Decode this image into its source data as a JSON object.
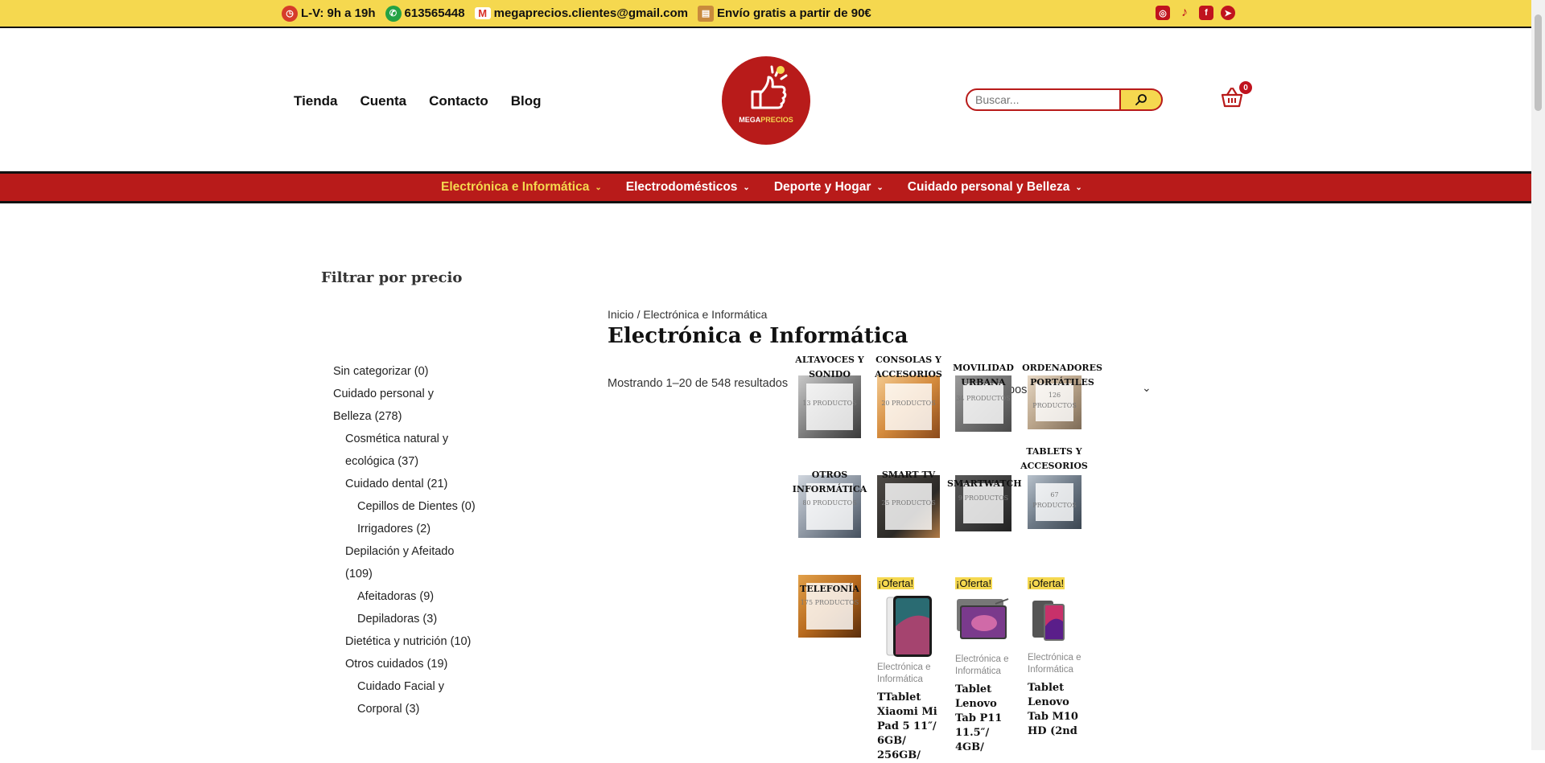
{
  "topbar": {
    "hours": "L-V: 9h a 19h",
    "phone": "613565448",
    "email": "megaprecios.clientes@gmail.com",
    "shipping": "Envío gratis a partir de 90€",
    "social_icons": [
      "instagram-icon",
      "tiktok-icon",
      "facebook-icon",
      "telegram-icon"
    ]
  },
  "nav": [
    "Tienda",
    "Cuenta",
    "Contacto",
    "Blog"
  ],
  "logo": {
    "part1": "MEGA",
    "part2": "PRECIOS"
  },
  "search": {
    "placeholder": "Buscar..."
  },
  "cart": {
    "count": "0"
  },
  "categories_menu": [
    {
      "label": "Electrónica e Informática",
      "active": true
    },
    {
      "label": "Electrodomésticos"
    },
    {
      "label": "Deporte y Hogar"
    },
    {
      "label": "Cuidado personal y Belleza"
    }
  ],
  "sidebar": {
    "filter_title": "Filtrar por precio",
    "categories": [
      {
        "label": "Sin categorizar",
        "count": "(0)"
      },
      {
        "label": "Cuidado personal y Belleza",
        "count": "(278)"
      },
      {
        "label": "Cosmética natural y ecológica",
        "count": "(37)"
      },
      {
        "label": "Cuidado dental",
        "count": "(21)"
      },
      {
        "label": "Cepillos de Dientes",
        "count": "(0)"
      },
      {
        "label": "Irrigadores",
        "count": "(2)"
      },
      {
        "label": "Depilación y Afeitado",
        "count": "(109)"
      },
      {
        "label": "Afeitadoras",
        "count": "(9)"
      },
      {
        "label": "Depiladoras",
        "count": "(3)"
      },
      {
        "label": "Dietética y nutrición",
        "count": "(10)"
      },
      {
        "label": "Otros cuidados",
        "count": "(19)"
      },
      {
        "label": "Cuidado Facial y Corporal",
        "count": "(3)"
      }
    ]
  },
  "main": {
    "breadcrumb": {
      "home": "Inicio",
      "sep": " / ",
      "current": "Electrónica e Informática"
    },
    "title": "Electrónica e Informática",
    "result_count": "Mostrando 1–20 de 548 resultados",
    "sort_label": "pos",
    "subcategories": [
      {
        "name": "ALTAVOCES Y SONIDO",
        "count": "13 PRODUCTOS"
      },
      {
        "name": "CONSOLAS Y ACCESORIOS",
        "count": "20 PRODUCTOS"
      },
      {
        "name": "MOVILIDAD URBANA",
        "count": "34 PRODUCTOS"
      },
      {
        "name": "ORDENADORES PORTÁTILES",
        "count": "126 PRODUCTOS"
      },
      {
        "name": "OTROS INFORMÁTICA",
        "count": "80 PRODUCTOS"
      },
      {
        "name": "SMART TV",
        "count": "25 PRODUCTOS"
      },
      {
        "name": "SMARTWATCH",
        "count": "9 PRODUCTOS"
      },
      {
        "name": "TABLETS Y ACCESORIOS",
        "count": "67 PRODUCTOS"
      },
      {
        "name": "TELEFONÍA",
        "count": "175 PRODUCTOS"
      }
    ],
    "products": [
      {
        "badge": "¡Oferta!",
        "category": "Electrónica e Informática",
        "name": "TTablet Xiaomi Mi Pad 5 11″/ 6GB/ 256GB/"
      },
      {
        "badge": "¡Oferta!",
        "category": "Electrónica e Informática",
        "name": "Tablet Lenovo Tab P11 11.5″/ 4GB/"
      },
      {
        "badge": "¡Oferta!",
        "category": "Electrónica e Informática",
        "name": "Tablet Lenovo Tab M10 HD (2nd"
      }
    ]
  },
  "colors": {
    "brand_yellow": "#f5d84f",
    "brand_red": "#b81b1a"
  }
}
